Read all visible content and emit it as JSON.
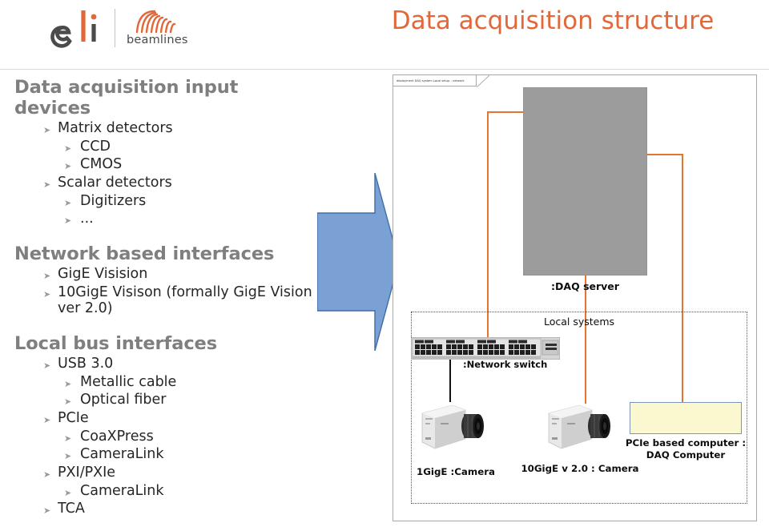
{
  "header": {
    "logo": {
      "mark_text": "eli",
      "word": "beamlines",
      "rays_icon": "radiating-arcs-icon"
    },
    "title": "Data acquisition structure",
    "title_color": "#e2683a"
  },
  "content": {
    "sections": [
      {
        "heading": "Data acquisition input devices",
        "items": [
          {
            "level": 1,
            "text": "Matrix detectors"
          },
          {
            "level": 2,
            "text": "CCD"
          },
          {
            "level": 2,
            "text": "CMOS"
          },
          {
            "level": 1,
            "text": "Scalar detectors"
          },
          {
            "level": 2,
            "text": "Digitizers"
          },
          {
            "level": 2,
            "text": "..."
          }
        ]
      },
      {
        "heading": "Network based interfaces",
        "items": [
          {
            "level": 1,
            "text": "GigE Visision"
          },
          {
            "level": 1,
            "text": "10GigE Visison (formally GigE Vision ver 2.0)"
          }
        ]
      },
      {
        "heading": "Local bus interfaces",
        "items": [
          {
            "level": 1,
            "text": "USB 3.0"
          },
          {
            "level": 2,
            "text": "Metallic cable"
          },
          {
            "level": 2,
            "text": "Optical fiber"
          },
          {
            "level": 1,
            "text": "PCIe"
          },
          {
            "level": 2,
            "text": "CoaXPress"
          },
          {
            "level": 2,
            "text": "CameraLink"
          },
          {
            "level": 1,
            "text": "PXI/PXIe"
          },
          {
            "level": 2,
            "text": "CameraLink"
          },
          {
            "level": 1,
            "text": "TCA"
          }
        ]
      }
    ],
    "bullet_glyph": "➤",
    "heading_color": "#7f7f7f"
  },
  "arrow": {
    "name": "right-pointing-block-arrow",
    "fill": "#7ba0d4",
    "stroke": "#3e6da8"
  },
  "diagram": {
    "frame_label": "deployment DAQ system Local setup - network",
    "server": {
      "label": ":DAQ server",
      "fill": "#9c9c9c",
      "stroke": "#7e97b5"
    },
    "package": {
      "title": "Local systems"
    },
    "switch": {
      "label": ":Network switch",
      "icon": "network-switch-icon"
    },
    "cameras": [
      {
        "label": "1GigE :Camera",
        "icon": "industrial-camera-icon"
      },
      {
        "label": "10GigE v 2.0 : Camera",
        "icon": "industrial-camera-icon"
      }
    ],
    "computer": {
      "label": "PCIe based computer : DAQ Computer",
      "fill": "#fbf8d0",
      "stroke": "#7e97b5"
    },
    "connector_color": "#e3752e"
  }
}
